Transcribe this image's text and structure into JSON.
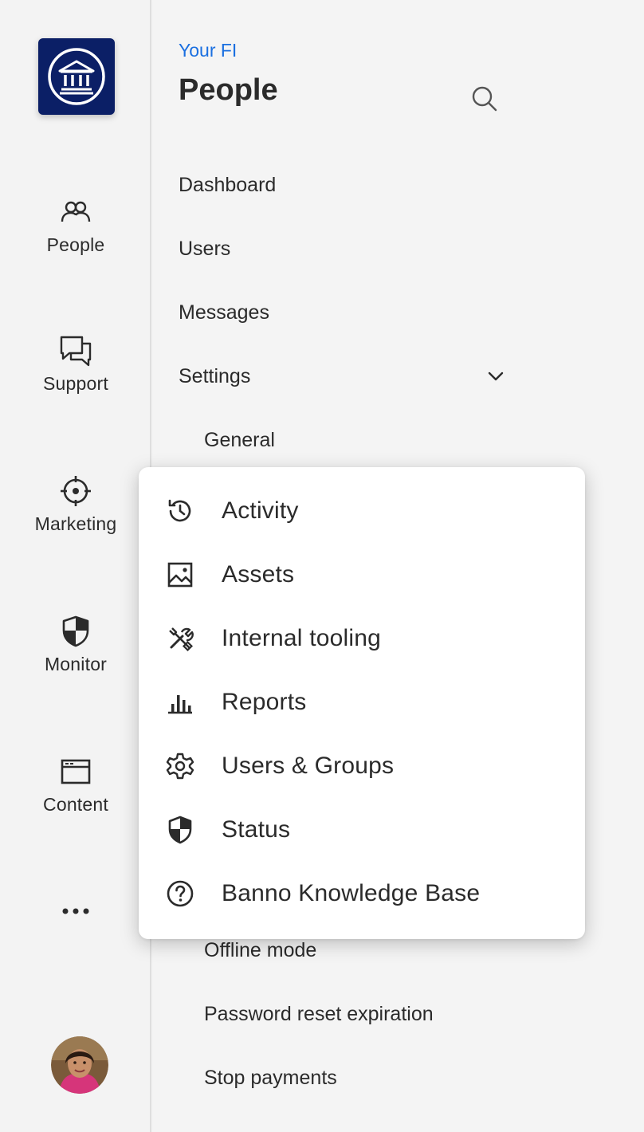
{
  "rail": {
    "logo_icon": "bank-building-icon",
    "items": [
      {
        "label": "People",
        "icon": "people-icon"
      },
      {
        "label": "Support",
        "icon": "chat-bubbles-icon"
      },
      {
        "label": "Marketing",
        "icon": "target-icon"
      },
      {
        "label": "Monitor",
        "icon": "shield-icon"
      },
      {
        "label": "Content",
        "icon": "browser-window-icon"
      }
    ],
    "more_icon": "more-horizontal-icon",
    "avatar": "user-avatar"
  },
  "panel": {
    "subtitle": "Your FI",
    "title": "People",
    "search_icon": "search-icon",
    "items": [
      {
        "label": "Dashboard"
      },
      {
        "label": "Users"
      },
      {
        "label": "Messages"
      },
      {
        "label": "Settings",
        "expanded": true
      }
    ],
    "sub_items": [
      {
        "label": "General"
      },
      {
        "label": "Offline mode"
      },
      {
        "label": "Password reset expiration"
      },
      {
        "label": "Stop payments"
      }
    ]
  },
  "menu": {
    "items": [
      {
        "label": "Activity",
        "icon": "history-icon"
      },
      {
        "label": "Assets",
        "icon": "image-icon"
      },
      {
        "label": "Internal tooling",
        "icon": "tools-icon"
      },
      {
        "label": "Reports",
        "icon": "bar-chart-icon"
      },
      {
        "label": "Users & Groups",
        "icon": "gear-icon"
      },
      {
        "label": "Status",
        "icon": "shield-icon"
      },
      {
        "label": "Banno Knowledge Base",
        "icon": "help-circle-icon"
      }
    ]
  },
  "colors": {
    "accent": "#1a6fe0",
    "logo_bg": "#0b1f66",
    "text": "#2b2b2b",
    "background": "#f4f4f4"
  }
}
